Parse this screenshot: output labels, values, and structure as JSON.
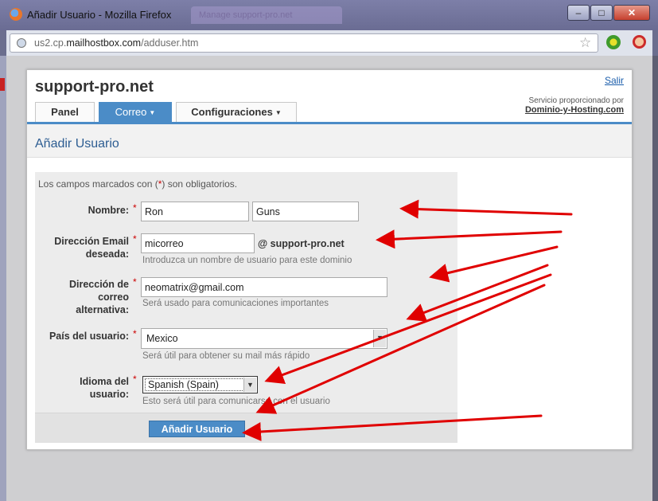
{
  "window": {
    "title": "Añadir Usuario - Mozilla Firefox",
    "background_tab": "Manage support-pro.net",
    "controls": {
      "minimize": "–",
      "maximize": "□",
      "close": "✕"
    }
  },
  "browser": {
    "url_prefix": "us2.cp.",
    "url_host": "mailhostbox.com",
    "url_path": "/adduser.htm",
    "icons": [
      "globe-icon",
      "bookmark-star-icon",
      "addon-green-icon",
      "addon-block-icon"
    ]
  },
  "page": {
    "site_name": "support-pro.net",
    "logout_label": "Salir",
    "provided_by_label": "Servicio proporcionado por",
    "provider_name": "Dominio-y-Hosting.com",
    "tabs": [
      {
        "label": "Panel"
      },
      {
        "label": "Correo",
        "active": true
      },
      {
        "label": "Configuraciones"
      }
    ],
    "heading": "Añadir Usuario",
    "accent_color": "#4b8cc7"
  },
  "form": {
    "required_note_pre": "Los campos marcados con (",
    "required_note_ast": "*",
    "required_note_post": ") son obligatorios.",
    "required_marker": "*",
    "name": {
      "label": "Nombre:",
      "first_value": "Ron",
      "last_value": "Guns"
    },
    "email": {
      "label_line1": "Dirección Email",
      "label_line2": "deseada:",
      "value": "micorreo",
      "domain_suffix": "@ support-pro.net",
      "hint": "Introduzca un nombre de usuario para este dominio"
    },
    "alt_email": {
      "label_line1": "Dirección de",
      "label_line2": "correo",
      "label_line3": "alternativa:",
      "value": "neomatrix@gmail.com",
      "hint": "Será usado para comunicaciones importantes"
    },
    "country": {
      "label": "País del usuario:",
      "value": "Mexico",
      "hint": "Será útil para obtener su mail más rápido"
    },
    "language": {
      "label_line1": "Idioma del",
      "label_line2": "usuario:",
      "value": "Spanish (Spain)",
      "hint": "Esto será útil para comunicarse con el usuario"
    },
    "submit_label": "Añadir Usuario"
  },
  "annotations": {
    "arrow_color": "#e00000"
  }
}
